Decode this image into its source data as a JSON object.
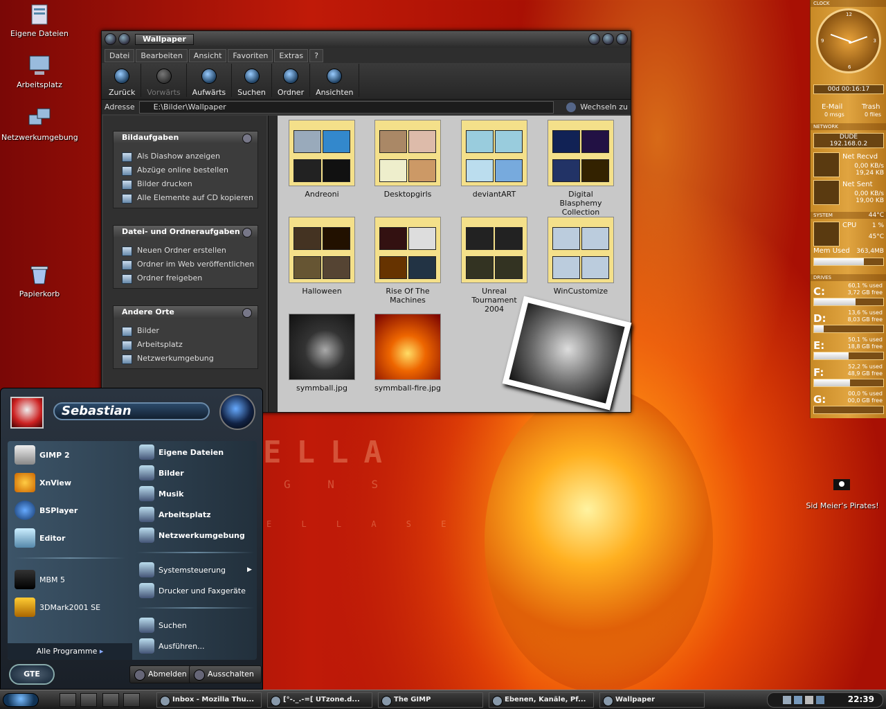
{
  "desktop": {
    "icons": [
      {
        "label": "Eigene Dateien"
      },
      {
        "label": "Arbeitsplatz"
      },
      {
        "label": "Netzwerkumgebung"
      },
      {
        "label": "Papierkorb"
      },
      {
        "label": "Sid Meier's Pirates!"
      }
    ]
  },
  "explorer": {
    "title": "Wallpaper",
    "menu": [
      "Datei",
      "Bearbeiten",
      "Ansicht",
      "Favoriten",
      "Extras",
      "?"
    ],
    "toolbar": {
      "back": "Zurück",
      "forward": "Vorwärts",
      "up": "Aufwärts",
      "search": "Suchen",
      "folders": "Ordner",
      "views": "Ansichten"
    },
    "address": {
      "label": "Adresse",
      "value": "E:\\Bilder\\Wallpaper",
      "go": "Wechseln zu"
    },
    "panels": [
      {
        "title": "Bildaufgaben",
        "items": [
          "Als Diashow anzeigen",
          "Abzüge online bestellen",
          "Bilder drucken",
          "Alle Elemente auf CD kopieren"
        ]
      },
      {
        "title": "Datei- und Ordneraufgaben",
        "items": [
          "Neuen Ordner erstellen",
          "Ordner im Web veröffentlichen",
          "Ordner freigeben"
        ]
      },
      {
        "title": "Andere Orte",
        "items": [
          "Bilder",
          "Arbeitsplatz",
          "Netzwerkumgebung"
        ]
      }
    ],
    "files": [
      "Andreoni",
      "Desktopgirls",
      "deviantART",
      "Digital Blasphemy Collection",
      "Halloween",
      "Rise Of The Machines",
      "Unreal Tournament 2004",
      "WinCustomize",
      "symmball.jpg",
      "symmball-fire.jpg"
    ]
  },
  "startmenu": {
    "user": "Sebastian",
    "left": [
      "GIMP 2",
      "XnView",
      "BSPlayer",
      "Editor",
      "MBM 5",
      "3DMark2001 SE"
    ],
    "right": [
      "Eigene Dateien",
      "Bilder",
      "Musik",
      "Arbeitsplatz",
      "Netzwerkumgebung",
      "Systemsteuerung",
      "Drucker und Faxgeräte",
      "Suchen",
      "Ausführen..."
    ],
    "all_programs": "Alle Programme",
    "logoff": "Abmelden",
    "shutdown": "Ausschalten",
    "logo": "GTE"
  },
  "background_text": {
    "line1": "ELLA",
    "line2": "G N S",
    "line3": "E L L A S E"
  },
  "taskbar": {
    "tasks": [
      "Inbox - Mozilla Thu...",
      "[°-._.-=[ UTzone.d...",
      "The GIMP",
      "Ebenen, Kanäle, Pf...",
      "Wallpaper"
    ],
    "clock": "22:39"
  },
  "sidebar": {
    "clock": {
      "caption": "CLOCK",
      "uptime": "00d 00:16:17",
      "numerals": [
        "12",
        "3",
        "6",
        "9"
      ]
    },
    "mail": {
      "label": "E-Mail",
      "value": "0 msgs"
    },
    "trash": {
      "label": "Trash",
      "value": "0 files"
    },
    "network": {
      "caption": "NETWORK",
      "host": "DUDE",
      "ip": "192.168.0.2",
      "recv_label": "Net Recvd",
      "recv_rate": "0,00 KB/s",
      "recv_total": "19,24 KB",
      "sent_label": "Net Sent",
      "sent_rate": "0,00 KB/s",
      "sent_total": "19,00 KB"
    },
    "system": {
      "caption": "SYSTEM",
      "temp1": "44°C",
      "cpu_label": "CPU",
      "cpu_value": "1 %",
      "temp2": "45°C",
      "mem_label": "Mem Used",
      "mem_value": "363,4MB",
      "mem_fraction": 0.72
    },
    "drives_caption": "DRIVES",
    "drives": [
      {
        "letter": "C:",
        "used": "60,1 % used",
        "free": "3,72 GB free",
        "fraction": 0.601
      },
      {
        "letter": "D:",
        "used": "13,6 % used",
        "free": "8,03 GB free",
        "fraction": 0.136
      },
      {
        "letter": "E:",
        "used": "50,1 % used",
        "free": "18,8 GB free",
        "fraction": 0.501
      },
      {
        "letter": "F:",
        "used": "52,2 % used",
        "free": "48,9 GB free",
        "fraction": 0.522
      },
      {
        "letter": "G:",
        "used": "00,0 % used",
        "free": "00,0 GB free",
        "fraction": 0.0
      }
    ]
  }
}
